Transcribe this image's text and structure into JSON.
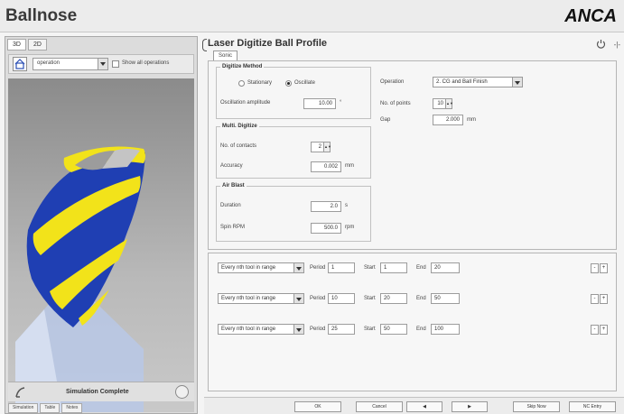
{
  "app": {
    "title": "Ballnose",
    "brand": "ANCA"
  },
  "left": {
    "view_tabs": [
      "3D",
      "2D"
    ],
    "operation_select": "operation",
    "show_all_label": "Show all operations",
    "status": "Simulation Complete",
    "bottom_tabs": [
      "Simulation",
      "Table",
      "Notes"
    ]
  },
  "panel": {
    "title": "Laser Digitize Ball Profile",
    "tab": "Sonic",
    "digitize_method": {
      "title": "Digitize Method",
      "stationary": "Stationary",
      "oscillate": "Oscillate",
      "selected": "Oscillate",
      "amplitude_label": "Oscillation amplitude",
      "amplitude_value": "10.00",
      "amplitude_unit": "°"
    },
    "multi_digitize": {
      "title": "Multi. Digitize",
      "contacts_label": "No. of contacts",
      "contacts_value": "2",
      "accuracy_label": "Accuracy",
      "accuracy_value": "0.002",
      "accuracy_unit": "mm"
    },
    "air_blast": {
      "title": "Air Blast",
      "duration_label": "Duration",
      "duration_value": "2.0",
      "duration_unit": "s",
      "spin_label": "Spin RPM",
      "spin_value": "500.0",
      "spin_unit": "rpm"
    },
    "operation_label": "Operation",
    "operation_value": "2. CG and Ball Finish",
    "points_label": "No. of points",
    "points_value": "10",
    "gap_label": "Gap",
    "gap_value": "2.000",
    "gap_unit": "mm",
    "ranges": [
      {
        "mode": "Every nth tool in range",
        "period_label": "Period",
        "period": "1",
        "start_label": "Start",
        "start": "1",
        "end_label": "End",
        "end": "20"
      },
      {
        "mode": "Every nth tool in range",
        "period_label": "Period",
        "period": "10",
        "start_label": "Start",
        "start": "20",
        "end_label": "End",
        "end": "50"
      },
      {
        "mode": "Every nth tool in range",
        "period_label": "Period",
        "period": "25",
        "start_label": "Start",
        "start": "50",
        "end_label": "End",
        "end": "100"
      }
    ],
    "buttons": {
      "ok": "OK",
      "cancel": "Cancel",
      "prev": "◀",
      "next": "▶",
      "skip": "Skip Now",
      "ncentry": "NC Entry"
    }
  },
  "colors": {
    "header_bg": "#ececec",
    "tool_blue": "#1f3fb3",
    "tool_yellow": "#f2e31a",
    "shank": "#b8c8e6"
  }
}
